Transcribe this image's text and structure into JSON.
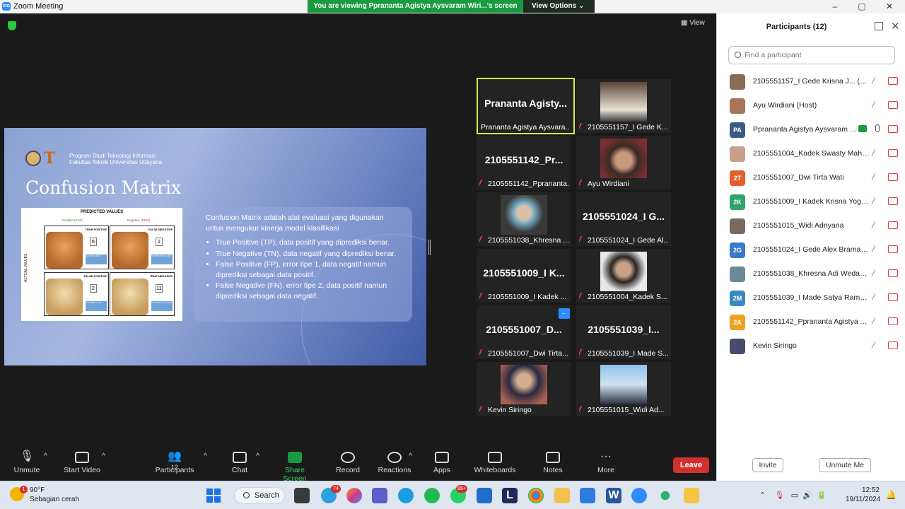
{
  "window": {
    "title": "Zoom Meeting",
    "logo": "zm"
  },
  "banner": {
    "message": "You are viewing Pprananta Agistya Aysvaram Wiri...'s screen",
    "view_options": "View Options"
  },
  "stage": {
    "view_label": "View"
  },
  "slide": {
    "institution_line1": "Program Studi Teknologi Informasi",
    "institution_line2": "Fakultas Teknik Universitas Udayana",
    "title": "Confusion Matrix",
    "matrix": {
      "header": "PREDICTED VALUES",
      "positive_label": "Positive (CAT)",
      "negative_label": "Negative (DOG)",
      "actual_label": "ACTUAL VALUES",
      "cells": [
        {
          "label": "TRUE POSITIVE",
          "value": "6",
          "tag": "YOU'RE A CAT"
        },
        {
          "label": "FALSE NEGATIVE",
          "value": "1",
          "tag": "YOU'RE NOT A CAT"
        },
        {
          "label": "FALSE POSITIVE",
          "value": "2",
          "tag": "YOU ARE A CAT"
        },
        {
          "label": "TRUE NEGATIVE",
          "value": "11",
          "tag": "YOU ARE NOT A CAT"
        }
      ]
    },
    "description": "Confusion Matrix adalah alat evaluasi yang digunakan untuk mengukur kinerja model klasifikasi",
    "bullets": [
      "True Positive (TP), data positif yang diprediksi benar.",
      "True Negative (TN), data negatif yang diprediksi benar.",
      "False Positive (FP), error tipe 1, data negatif namun diprediksi sebagai data positif.",
      "False Negative (FN), error tipe 2, data positif namun diprediksi sebagai data negatif."
    ]
  },
  "tiles": [
    {
      "big": "Prananta  Agisty...",
      "name": "Prananta Agistya Aysvara..."
    },
    {
      "big": "",
      "name": "2105551157_I Gede K..."
    },
    {
      "big": "2105551142_Pr...",
      "name": "2105551142_Pprananta..."
    },
    {
      "big": "",
      "name": "Ayu Wirdiani"
    },
    {
      "big": "",
      "name": "2105551038_Khresna ..."
    },
    {
      "big": "2105551024_I  G...",
      "name": "2105551024_I Gede Al..."
    },
    {
      "big": "2105551009_I  K...",
      "name": "2105551009_I Kadek ..."
    },
    {
      "big": "",
      "name": "2105551004_Kadek S..."
    },
    {
      "big": "2105551007_D...",
      "name": "2105551007_Dwi Tirta..."
    },
    {
      "big": "2105551039_I...",
      "name": "2105551039_I Made S..."
    },
    {
      "big": "",
      "name": "Kevin Siringo"
    },
    {
      "big": "",
      "name": "2105551015_Widi Ad..."
    }
  ],
  "tile_more": "...",
  "toolbar": {
    "unmute": "Unmute",
    "start_video": "Start Video",
    "participants": "Participants",
    "participants_count": "12",
    "chat": "Chat",
    "share_screen": "Share Screen",
    "record": "Record",
    "reactions": "Reactions",
    "apps": "Apps",
    "whiteboards": "Whiteboards",
    "notes": "Notes",
    "more": "More",
    "leave": "Leave"
  },
  "panel": {
    "title": "Participants (12)",
    "search_placeholder": "Find a participant",
    "invite": "Invite",
    "unmute_me": "Unmute Me",
    "participants": [
      {
        "initials": "",
        "color": "#8a6b55",
        "name": "2105551157_I Gede Krisna J... (Me)"
      },
      {
        "initials": "",
        "color": "#a8745a",
        "name": "Ayu Wirdiani (Host)"
      },
      {
        "initials": "PA",
        "color": "#3a5a85",
        "name": "Pprananta Agistya Aysvaram ..."
      },
      {
        "initials": "",
        "color": "#c8a090",
        "name": "2105551004_Kadek Swasty Maha..."
      },
      {
        "initials": "2T",
        "color": "#e0622a",
        "name": "2105551007_Dwi Tirta Wati"
      },
      {
        "initials": "2K",
        "color": "#2fa56a",
        "name": "2105551009_I Kadek Krisna Yoga ..."
      },
      {
        "initials": "",
        "color": "#7a6a60",
        "name": "2105551015_Widi Adnyana"
      },
      {
        "initials": "2G",
        "color": "#3a7ac8",
        "name": "2105551024_I Gede Alex Bramart..."
      },
      {
        "initials": "",
        "color": "#6a8a9a",
        "name": "2105551038_Khresna Adi Wedanta"
      },
      {
        "initials": "2M",
        "color": "#3a8ac0",
        "name": "2105551039_I Made Satya Rama ..."
      },
      {
        "initials": "2A",
        "color": "#f0a020",
        "name": "2105551142_Pprananta Agistya Ay..."
      },
      {
        "initials": "",
        "color": "#4a4a6a",
        "name": "Kevin Siringo"
      }
    ]
  },
  "taskbar": {
    "weather_temp": "90°F",
    "weather_desc": "Sebagian cerah",
    "weather_badge": "1",
    "search": "Search",
    "telegram_badge": "74",
    "whatsapp_badge": "99+",
    "time": "12:52",
    "date": "19/11/2024"
  }
}
